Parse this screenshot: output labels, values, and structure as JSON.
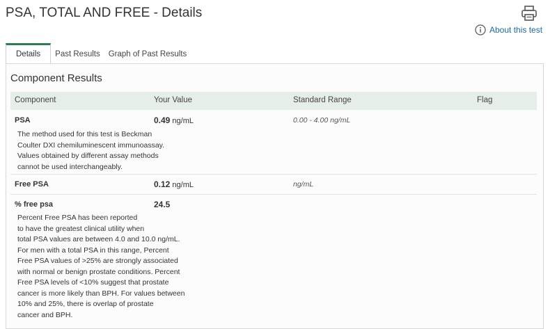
{
  "header": {
    "title": "PSA, TOTAL AND FREE - Details",
    "about_label": "About this test"
  },
  "icons": [
    "print-icon",
    "info-icon"
  ],
  "colors": {
    "accent": "#2e7d4f",
    "link": "#1a6aa8",
    "header_bg": "#e6efe7"
  },
  "tabs": [
    {
      "label": "Details",
      "active": true
    },
    {
      "label": "Past Results",
      "active": false
    },
    {
      "label": "Graph of Past Results",
      "active": false
    }
  ],
  "section_title": "Component Results",
  "columns": {
    "component": "Component",
    "your_value": "Your Value",
    "standard_range": "Standard Range",
    "flag": "Flag"
  },
  "results": [
    {
      "name": "PSA",
      "value": "0.49",
      "unit": "ng/mL",
      "range": "0.00 - 4.00 ng/mL",
      "flag": "",
      "note": "The method used for this test is Beckman\nCoulter DXI chemiluminescent immunoassay.\nValues obtained by different assay methods\ncannot be used interchangeably."
    },
    {
      "name": "Free PSA",
      "value": "0.12",
      "unit": "ng/mL",
      "range": "ng/mL",
      "flag": "",
      "note": ""
    },
    {
      "name": "% free psa",
      "value": "24.5",
      "unit": "",
      "range": "",
      "flag": "",
      "note": "Percent Free PSA has been reported\nto have the greatest clinical utility when\ntotal PSA values are between 4.0 and 10.0 ng/mL.\nFor men with a total PSA in this range, Percent\nFree PSA values of >25% are strongly associated\nwith normal or benign prostate conditions. Percent\nFree PSA levels of <10% suggest that prostate\ncancer is more likely than BPH. For values between\n10% and 25%, there is overlap of prostate\ncancer and BPH."
    }
  ]
}
